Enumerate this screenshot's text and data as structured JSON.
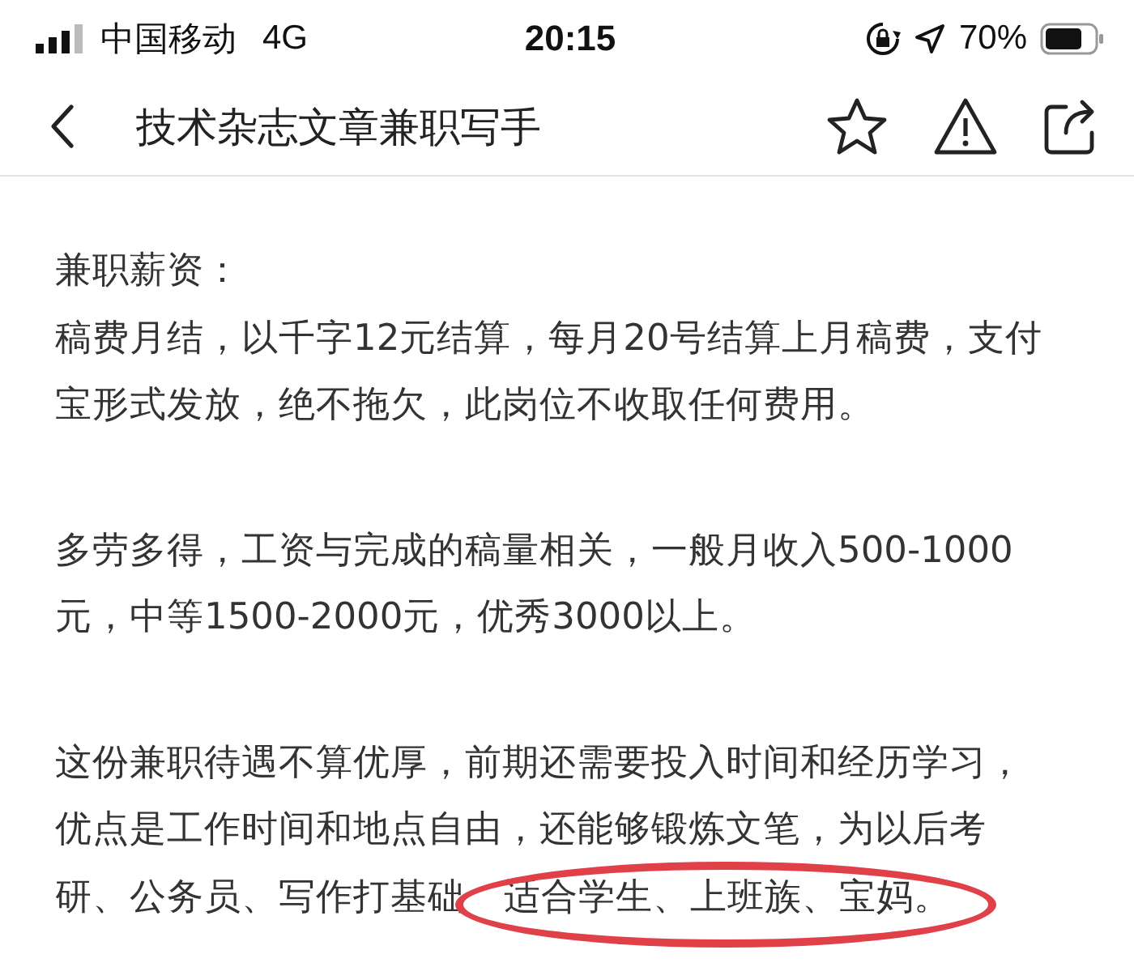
{
  "status_bar": {
    "carrier": "中国移动",
    "network": "4G",
    "time": "20:15",
    "battery": "70%"
  },
  "header": {
    "title": "技术杂志文章兼职写手"
  },
  "paragraphs": [
    {
      "lines": [
        [
          {
            "text": "兼职薪资："
          }
        ],
        [
          {
            "text": "稿费月结，以千字12元结算，每月20号结算上月稿费，支付"
          }
        ],
        [
          {
            "text": "宝形式发放，绝不拖欠，此岗位不收取任何费用。"
          }
        ]
      ]
    },
    {
      "lines": [
        [
          {
            "text": "多劳多得，工资与完成的稿量相关，一般月收入500-1000"
          }
        ],
        [
          {
            "text": "元，中等1500-2000元，优秀3000以上。"
          }
        ]
      ]
    },
    {
      "lines": [
        [
          {
            "text": "这份兼职待遇不算优厚，前期还需要投入时间和经历学习，"
          }
        ],
        [
          {
            "text": "优点是工作时间和地点自由，还能够锻炼文笔，为以后考"
          }
        ],
        [
          {
            "text": "研、公务员、写作打基础",
            "circled": false
          },
          {
            "text": "适合学生、上班族、宝妈。",
            "circled": true
          }
        ]
      ]
    }
  ]
}
